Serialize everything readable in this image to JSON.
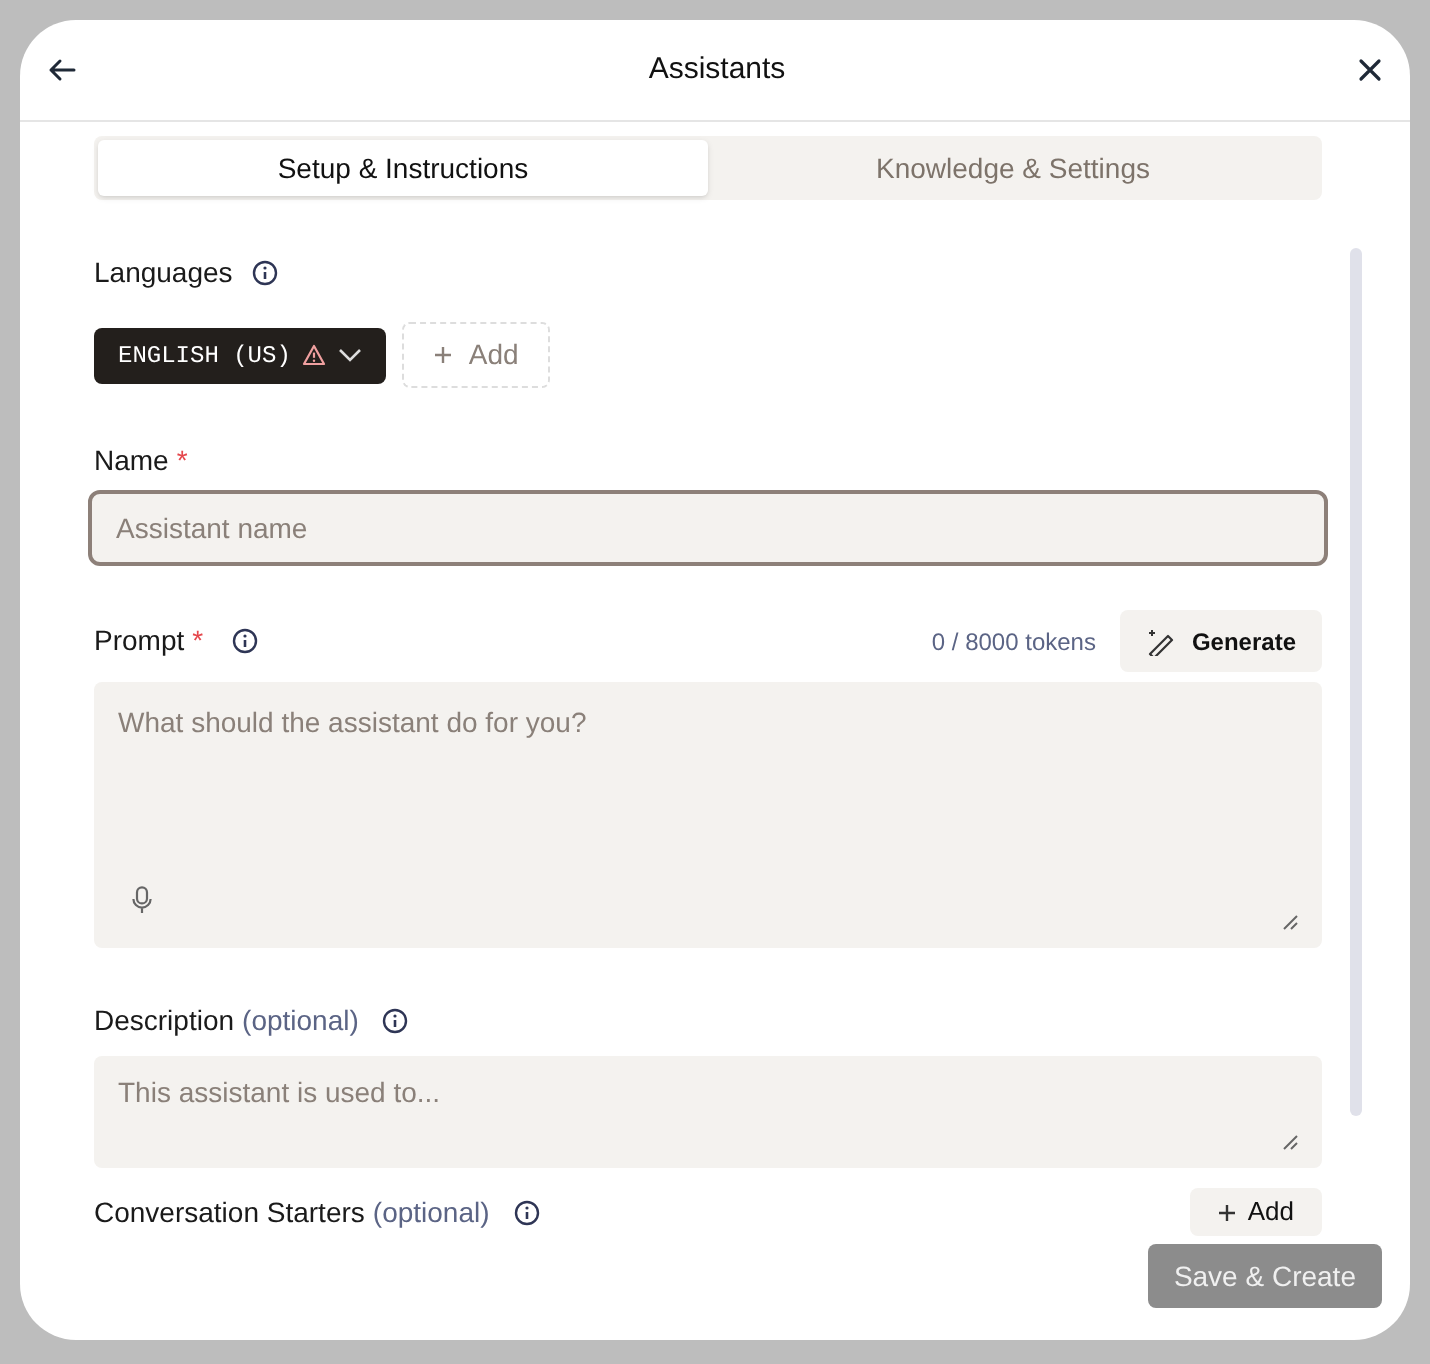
{
  "header": {
    "title": "Assistants"
  },
  "tabs": [
    {
      "label": "Setup & Instructions",
      "selected": true
    },
    {
      "label": "Knowledge & Settings",
      "selected": false
    }
  ],
  "languages": {
    "label": "Languages",
    "chips": [
      {
        "label": "ENGLISH (US)",
        "warning": true
      }
    ],
    "add_label": "Add"
  },
  "name_field": {
    "label": "Name",
    "required_mark": "*",
    "placeholder": "Assistant name"
  },
  "prompt_field": {
    "label": "Prompt",
    "required_mark": "*",
    "token_count": "0 / 8000 tokens",
    "generate_label": "Generate",
    "placeholder": "What should the assistant do for you?"
  },
  "description_field": {
    "label": "Description",
    "optional_note": "(optional)",
    "placeholder": "This assistant is used to..."
  },
  "conversation_starters": {
    "label": "Conversation Starters",
    "optional_note": "(optional)",
    "add_label": "Add"
  },
  "footer": {
    "save_label": "Save & Create",
    "disabled": true
  }
}
